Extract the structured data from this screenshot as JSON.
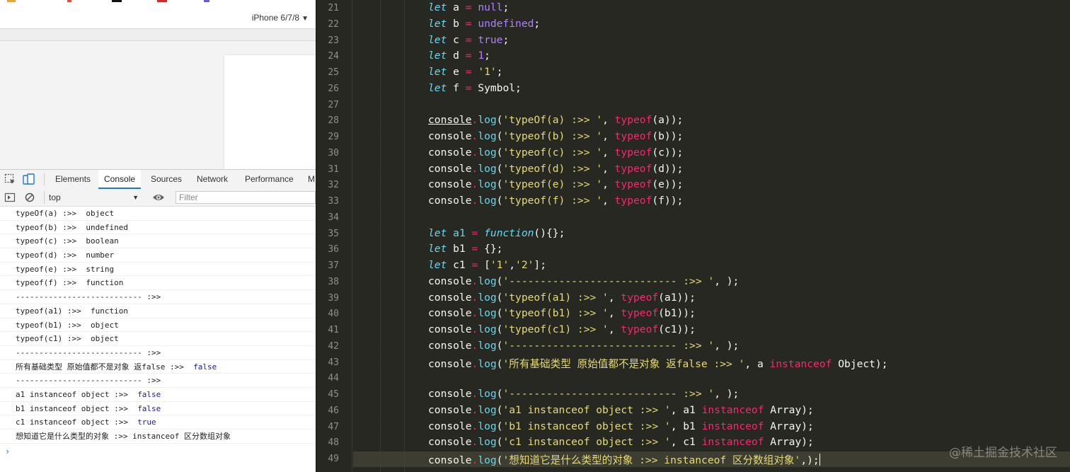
{
  "browser": {
    "device_label": "iPhone 6/7/8"
  },
  "devtools": {
    "tabs": [
      "Elements",
      "Console",
      "Sources",
      "Network",
      "Performance",
      "M"
    ],
    "active_tab": "Console",
    "context": "top",
    "filter_placeholder": "Filter"
  },
  "console": {
    "rows": [
      {
        "label": "typeOf(a) :>>  ",
        "value": "object",
        "kind": "str"
      },
      {
        "label": "typeof(b) :>>  ",
        "value": "undefined",
        "kind": "str"
      },
      {
        "label": "typeof(c) :>>  ",
        "value": "boolean",
        "kind": "str"
      },
      {
        "label": "typeof(d) :>>  ",
        "value": "number",
        "kind": "str"
      },
      {
        "label": "typeof(e) :>>  ",
        "value": "string",
        "kind": "str"
      },
      {
        "label": "typeof(f) :>>  ",
        "value": "function",
        "kind": "str"
      },
      {
        "label": "--------------------------- :>>",
        "value": "",
        "kind": "str"
      },
      {
        "label": "typeof(a1) :>>  ",
        "value": "function",
        "kind": "str"
      },
      {
        "label": "typeof(b1) :>>  ",
        "value": "object",
        "kind": "str"
      },
      {
        "label": "typeof(c1) :>>  ",
        "value": "object",
        "kind": "str"
      },
      {
        "label": "--------------------------- :>>",
        "value": "",
        "kind": "str"
      },
      {
        "label": "所有基础类型 原始值都不是对象 返false :>>  ",
        "value": "false",
        "kind": "bool"
      },
      {
        "label": "--------------------------- :>>",
        "value": "",
        "kind": "str"
      },
      {
        "label": "a1 instanceof object :>>  ",
        "value": "false",
        "kind": "bool"
      },
      {
        "label": "b1 instanceof object :>>  ",
        "value": "false",
        "kind": "bool"
      },
      {
        "label": "c1 instanceof object :>>  ",
        "value": "true",
        "kind": "bool"
      },
      {
        "label": "想知道它是什么类型的对象 :>> instanceof 区分数组对象",
        "value": "",
        "kind": "str"
      }
    ],
    "prompt": "›"
  },
  "editor": {
    "lines": [
      {
        "n": 21,
        "tokens": [
          [
            "kw",
            "let"
          ],
          [
            "id",
            " a "
          ],
          [
            "op",
            "="
          ],
          [
            "id",
            " "
          ],
          [
            "cst",
            "null"
          ],
          [
            "punc",
            ";"
          ]
        ]
      },
      {
        "n": 22,
        "tokens": [
          [
            "kw",
            "let"
          ],
          [
            "id",
            " b "
          ],
          [
            "op",
            "="
          ],
          [
            "id",
            " "
          ],
          [
            "cst",
            "undefined"
          ],
          [
            "punc",
            ";"
          ]
        ]
      },
      {
        "n": 23,
        "tokens": [
          [
            "kw",
            "let"
          ],
          [
            "id",
            " c "
          ],
          [
            "op",
            "="
          ],
          [
            "id",
            " "
          ],
          [
            "cst",
            "true"
          ],
          [
            "punc",
            ";"
          ]
        ]
      },
      {
        "n": 24,
        "tokens": [
          [
            "kw",
            "let"
          ],
          [
            "id",
            " d "
          ],
          [
            "op",
            "="
          ],
          [
            "id",
            " "
          ],
          [
            "cst",
            "1"
          ],
          [
            "punc",
            ";"
          ]
        ]
      },
      {
        "n": 25,
        "tokens": [
          [
            "kw",
            "let"
          ],
          [
            "id",
            " e "
          ],
          [
            "op",
            "="
          ],
          [
            "id",
            " "
          ],
          [
            "str",
            "'1'"
          ],
          [
            "punc",
            ";"
          ]
        ]
      },
      {
        "n": 26,
        "tokens": [
          [
            "kw",
            "let"
          ],
          [
            "id",
            " f "
          ],
          [
            "op",
            "="
          ],
          [
            "id",
            " Symbol;"
          ]
        ]
      },
      {
        "n": 27,
        "tokens": []
      },
      {
        "n": 28,
        "tokens": [
          [
            "con ul",
            "console"
          ],
          [
            "op",
            "."
          ],
          [
            "fn",
            "log"
          ],
          [
            "punc",
            "("
          ],
          [
            "str",
            "'typeOf(a) :>> '"
          ],
          [
            "punc",
            ", "
          ],
          [
            "kw2",
            "typeof"
          ],
          [
            "punc",
            "(a));"
          ]
        ]
      },
      {
        "n": 29,
        "tokens": [
          [
            "con",
            "console"
          ],
          [
            "op",
            "."
          ],
          [
            "fn",
            "log"
          ],
          [
            "punc",
            "("
          ],
          [
            "str",
            "'typeof(b) :>> '"
          ],
          [
            "punc",
            ", "
          ],
          [
            "kw2",
            "typeof"
          ],
          [
            "punc",
            "(b));"
          ]
        ]
      },
      {
        "n": 30,
        "tokens": [
          [
            "con",
            "console"
          ],
          [
            "op",
            "."
          ],
          [
            "fn",
            "log"
          ],
          [
            "punc",
            "("
          ],
          [
            "str",
            "'typeof(c) :>> '"
          ],
          [
            "punc",
            ", "
          ],
          [
            "kw2",
            "typeof"
          ],
          [
            "punc",
            "(c));"
          ]
        ]
      },
      {
        "n": 31,
        "tokens": [
          [
            "con",
            "console"
          ],
          [
            "op",
            "."
          ],
          [
            "fn",
            "log"
          ],
          [
            "punc",
            "("
          ],
          [
            "str",
            "'typeof(d) :>> '"
          ],
          [
            "punc",
            ", "
          ],
          [
            "kw2",
            "typeof"
          ],
          [
            "punc",
            "(d));"
          ]
        ]
      },
      {
        "n": 32,
        "tokens": [
          [
            "con",
            "console"
          ],
          [
            "op",
            "."
          ],
          [
            "fn",
            "log"
          ],
          [
            "punc",
            "("
          ],
          [
            "str",
            "'typeof(e) :>> '"
          ],
          [
            "punc",
            ", "
          ],
          [
            "kw2",
            "typeof"
          ],
          [
            "punc",
            "(e));"
          ]
        ]
      },
      {
        "n": 33,
        "tokens": [
          [
            "con",
            "console"
          ],
          [
            "op",
            "."
          ],
          [
            "fn",
            "log"
          ],
          [
            "punc",
            "("
          ],
          [
            "str",
            "'typeof(f) :>> '"
          ],
          [
            "punc",
            ", "
          ],
          [
            "kw2",
            "typeof"
          ],
          [
            "punc",
            "(f));"
          ]
        ]
      },
      {
        "n": 34,
        "tokens": []
      },
      {
        "n": 35,
        "tokens": [
          [
            "kw",
            "let"
          ],
          [
            "id",
            " "
          ],
          [
            "fn",
            "a1"
          ],
          [
            "id",
            " "
          ],
          [
            "op",
            "="
          ],
          [
            "id",
            " "
          ],
          [
            "kw",
            "function"
          ],
          [
            "punc",
            "(){};"
          ]
        ]
      },
      {
        "n": 36,
        "tokens": [
          [
            "kw",
            "let"
          ],
          [
            "id",
            " b1 "
          ],
          [
            "op",
            "="
          ],
          [
            "id",
            " {};"
          ]
        ]
      },
      {
        "n": 37,
        "tokens": [
          [
            "kw",
            "let"
          ],
          [
            "id",
            " c1 "
          ],
          [
            "op",
            "="
          ],
          [
            "id",
            " ["
          ],
          [
            "str",
            "'1'"
          ],
          [
            "punc",
            ","
          ],
          [
            "str",
            "'2'"
          ],
          [
            "punc",
            "];"
          ]
        ]
      },
      {
        "n": 38,
        "tokens": [
          [
            "con",
            "console"
          ],
          [
            "op",
            "."
          ],
          [
            "fn",
            "log"
          ],
          [
            "punc",
            "("
          ],
          [
            "str",
            "'--------------------------- :>> '"
          ],
          [
            "punc",
            ", );"
          ]
        ]
      },
      {
        "n": 39,
        "tokens": [
          [
            "con",
            "console"
          ],
          [
            "op",
            "."
          ],
          [
            "fn",
            "log"
          ],
          [
            "punc",
            "("
          ],
          [
            "str",
            "'typeof(a1) :>> '"
          ],
          [
            "punc",
            ", "
          ],
          [
            "kw2",
            "typeof"
          ],
          [
            "punc",
            "(a1));"
          ]
        ]
      },
      {
        "n": 40,
        "tokens": [
          [
            "con",
            "console"
          ],
          [
            "op",
            "."
          ],
          [
            "fn",
            "log"
          ],
          [
            "punc",
            "("
          ],
          [
            "str",
            "'typeof(b1) :>> '"
          ],
          [
            "punc",
            ", "
          ],
          [
            "kw2",
            "typeof"
          ],
          [
            "punc",
            "(b1));"
          ]
        ]
      },
      {
        "n": 41,
        "tokens": [
          [
            "con",
            "console"
          ],
          [
            "op",
            "."
          ],
          [
            "fn",
            "log"
          ],
          [
            "punc",
            "("
          ],
          [
            "str",
            "'typeof(c1) :>> '"
          ],
          [
            "punc",
            ", "
          ],
          [
            "kw2",
            "typeof"
          ],
          [
            "punc",
            "(c1));"
          ]
        ]
      },
      {
        "n": 42,
        "tokens": [
          [
            "con",
            "console"
          ],
          [
            "op",
            "."
          ],
          [
            "fn",
            "log"
          ],
          [
            "punc",
            "("
          ],
          [
            "str",
            "'--------------------------- :>> '"
          ],
          [
            "punc",
            ", );"
          ]
        ]
      },
      {
        "n": 43,
        "tokens": [
          [
            "con",
            "console"
          ],
          [
            "op",
            "."
          ],
          [
            "fn",
            "log"
          ],
          [
            "punc",
            "("
          ],
          [
            "str",
            "'所有基础类型 原始值都不是对象 返false :>> '"
          ],
          [
            "punc",
            ", a "
          ],
          [
            "kw2",
            "instanceof"
          ],
          [
            "punc",
            " Object);"
          ]
        ]
      },
      {
        "n": 44,
        "tokens": []
      },
      {
        "n": 45,
        "tokens": [
          [
            "con",
            "console"
          ],
          [
            "op",
            "."
          ],
          [
            "fn",
            "log"
          ],
          [
            "punc",
            "("
          ],
          [
            "str",
            "'--------------------------- :>> '"
          ],
          [
            "punc",
            ", );"
          ]
        ]
      },
      {
        "n": 46,
        "tokens": [
          [
            "con",
            "console"
          ],
          [
            "op",
            "."
          ],
          [
            "fn",
            "log"
          ],
          [
            "punc",
            "("
          ],
          [
            "str",
            "'a1 instanceof object :>> '"
          ],
          [
            "punc",
            ", a1 "
          ],
          [
            "kw2",
            "instanceof"
          ],
          [
            "punc",
            " Array);"
          ]
        ]
      },
      {
        "n": 47,
        "tokens": [
          [
            "con",
            "console"
          ],
          [
            "op",
            "."
          ],
          [
            "fn",
            "log"
          ],
          [
            "punc",
            "("
          ],
          [
            "str",
            "'b1 instanceof object :>> '"
          ],
          [
            "punc",
            ", b1 "
          ],
          [
            "kw2",
            "instanceof"
          ],
          [
            "punc",
            " Array);"
          ]
        ]
      },
      {
        "n": 48,
        "tokens": [
          [
            "con",
            "console"
          ],
          [
            "op",
            "."
          ],
          [
            "fn",
            "log"
          ],
          [
            "punc",
            "("
          ],
          [
            "str",
            "'c1 instanceof object :>> '"
          ],
          [
            "punc",
            ", c1 "
          ],
          [
            "kw2",
            "instanceof"
          ],
          [
            "punc",
            " Array);"
          ]
        ]
      },
      {
        "n": 49,
        "tokens": [
          [
            "con",
            "console"
          ],
          [
            "op",
            "."
          ],
          [
            "fn",
            "log"
          ],
          [
            "punc",
            "("
          ],
          [
            "str",
            "'想知道它是什么类型的对象 :>> instanceof 区分数组对象'"
          ],
          [
            "punc",
            ",);"
          ]
        ]
      }
    ]
  },
  "watermark": "@稀土掘金技术社区",
  "colors": {
    "editor_bg": "#272822",
    "keyword": "#66d9ef",
    "operator": "#f92672",
    "string": "#e6db74",
    "constant": "#ae81ff",
    "devtools_active": "#1a73e8"
  }
}
